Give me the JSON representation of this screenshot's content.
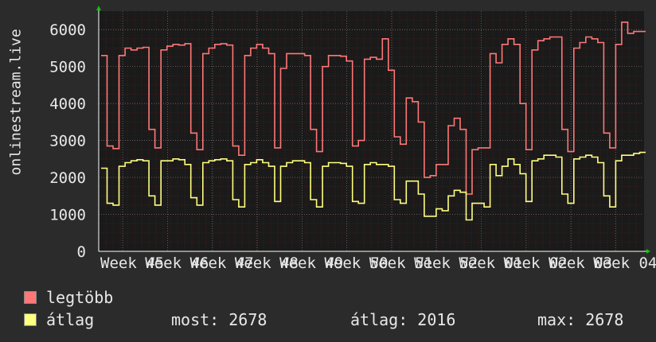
{
  "chart_data": {
    "type": "line",
    "ylabel": "onlinestream.live",
    "ylim": [
      0,
      6500
    ],
    "y_ticks": [
      "0",
      "1000",
      "2000",
      "3000",
      "4000",
      "5000",
      "6000"
    ],
    "x_ticks": [
      "Week 45",
      "Week 46",
      "Week 47",
      "Week 48",
      "Week 49",
      "Week 50",
      "Week 51",
      "Week 52",
      "Week 01",
      "Week 02",
      "Week 03",
      "Week 04"
    ],
    "grid": true,
    "series": [
      {
        "name": "legtöbb",
        "color": "#ff7777",
        "values": [
          5300,
          2850,
          2780,
          5300,
          5500,
          5450,
          5500,
          5520,
          3300,
          2800,
          5450,
          5550,
          5600,
          5580,
          5620,
          3200,
          2750,
          5350,
          5500,
          5600,
          5620,
          5580,
          2850,
          2600,
          5300,
          5500,
          5600,
          5500,
          5350,
          2800,
          4950,
          5350,
          5350,
          5350,
          5300,
          3300,
          2700,
          5000,
          5300,
          5300,
          5280,
          5150,
          2850,
          3000,
          5200,
          5250,
          5200,
          5750,
          4900,
          3100,
          2900,
          4150,
          4050,
          3500,
          2000,
          2050,
          2350,
          2350,
          3400,
          3600,
          3300,
          1550,
          2750,
          2800,
          2800,
          5350,
          5100,
          5600,
          5750,
          5600,
          4000,
          2750,
          5450,
          5700,
          5750,
          5800,
          5800,
          3300,
          2700,
          5500,
          5650,
          5800,
          5750,
          5650,
          3200,
          2800,
          5600,
          6200,
          5900,
          5950,
          5950
        ],
        "markers": [
          "6200",
          "5700"
        ]
      },
      {
        "name": "átlag",
        "color": "#ffff80",
        "values": [
          2250,
          1300,
          1250,
          2300,
          2400,
          2450,
          2480,
          2450,
          1500,
          1250,
          2450,
          2450,
          2500,
          2480,
          2350,
          1450,
          1250,
          2400,
          2450,
          2480,
          2500,
          2450,
          1400,
          1200,
          2350,
          2400,
          2480,
          2400,
          2300,
          1350,
          2300,
          2400,
          2450,
          2450,
          2400,
          1400,
          1200,
          2300,
          2400,
          2400,
          2380,
          2300,
          1350,
          1300,
          2350,
          2400,
          2350,
          2350,
          2300,
          1400,
          1300,
          1900,
          1900,
          1550,
          950,
          950,
          1150,
          1100,
          1500,
          1650,
          1600,
          850,
          1300,
          1300,
          1200,
          2350,
          2050,
          2300,
          2500,
          2350,
          2100,
          1350,
          2450,
          2500,
          2600,
          2600,
          2550,
          1550,
          1300,
          2500,
          2550,
          2600,
          2550,
          2400,
          1500,
          1200,
          2450,
          2600,
          2600,
          2650,
          2678
        ]
      }
    ]
  },
  "legend": [
    {
      "label": "legtöbb",
      "color": "#ff7777"
    },
    {
      "label": "átlag",
      "color": "#ffff80"
    }
  ],
  "stats": {
    "most": "most: 2678",
    "atlag": "átlag: 2016",
    "max": "max: 2678"
  }
}
